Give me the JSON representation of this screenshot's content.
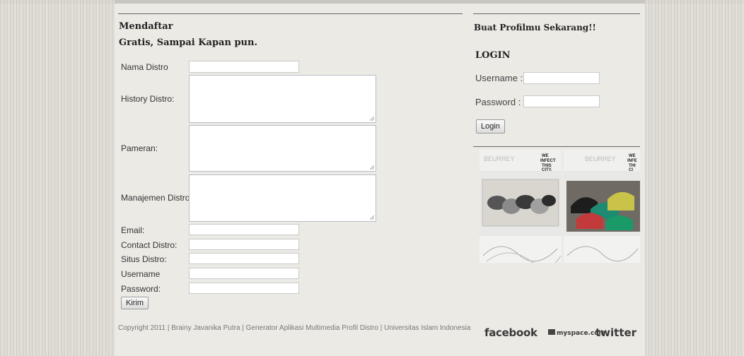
{
  "signup": {
    "title": "Mendaftar",
    "subtitle": "Gratis, Sampai Kapan pun.",
    "fields": {
      "nama_distro": "Nama Distro",
      "history": "History Distro:",
      "pameran": "Pameran:",
      "manajemen": "Manajemen Distro:",
      "email": "Email:",
      "contact": "Contact Distro:",
      "situs": "Situs Distro:",
      "username": "Username",
      "password": "Password:"
    },
    "submit_label": "Kirim"
  },
  "sidebar": {
    "headline": "Buat Profilmu Sekarang!!",
    "login_title": "LOGIN",
    "username_label": "Username :",
    "password_label": "Password  :",
    "login_button": "Login"
  },
  "footer": {
    "copyright": "Copyright 2011 | Brainy Javanika Putra | Generator Aplikasi Multimedia Profil Distro | Universitas Islam Indonesia"
  },
  "social": {
    "facebook": "facebook",
    "myspace": "myspace.com",
    "twitter": "twitter"
  },
  "colors": {
    "line": "#666666",
    "panel": "#eceae5"
  },
  "icons": [
    "belts-photo",
    "caps-photo",
    "facebook-logo",
    "myspace-logo",
    "twitter-logo"
  ]
}
